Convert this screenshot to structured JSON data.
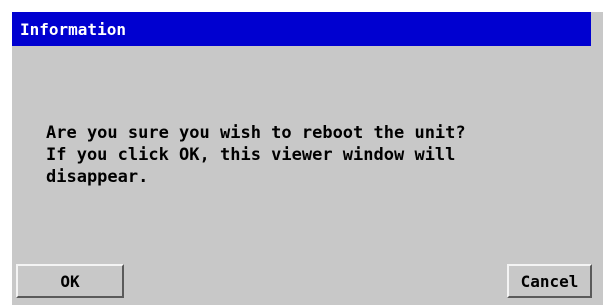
{
  "dialog": {
    "title": "Information",
    "message_lines": [
      "Are you sure you wish to reboot the unit?",
      "If you click OK, this viewer window will",
      "disappear."
    ],
    "buttons": {
      "ok_label": "OK",
      "cancel_label": "Cancel"
    }
  },
  "colors": {
    "titlebar": "#0000d0",
    "dialog_background": "#c8c8c8",
    "title_text": "#ffffff",
    "text": "#000000"
  }
}
